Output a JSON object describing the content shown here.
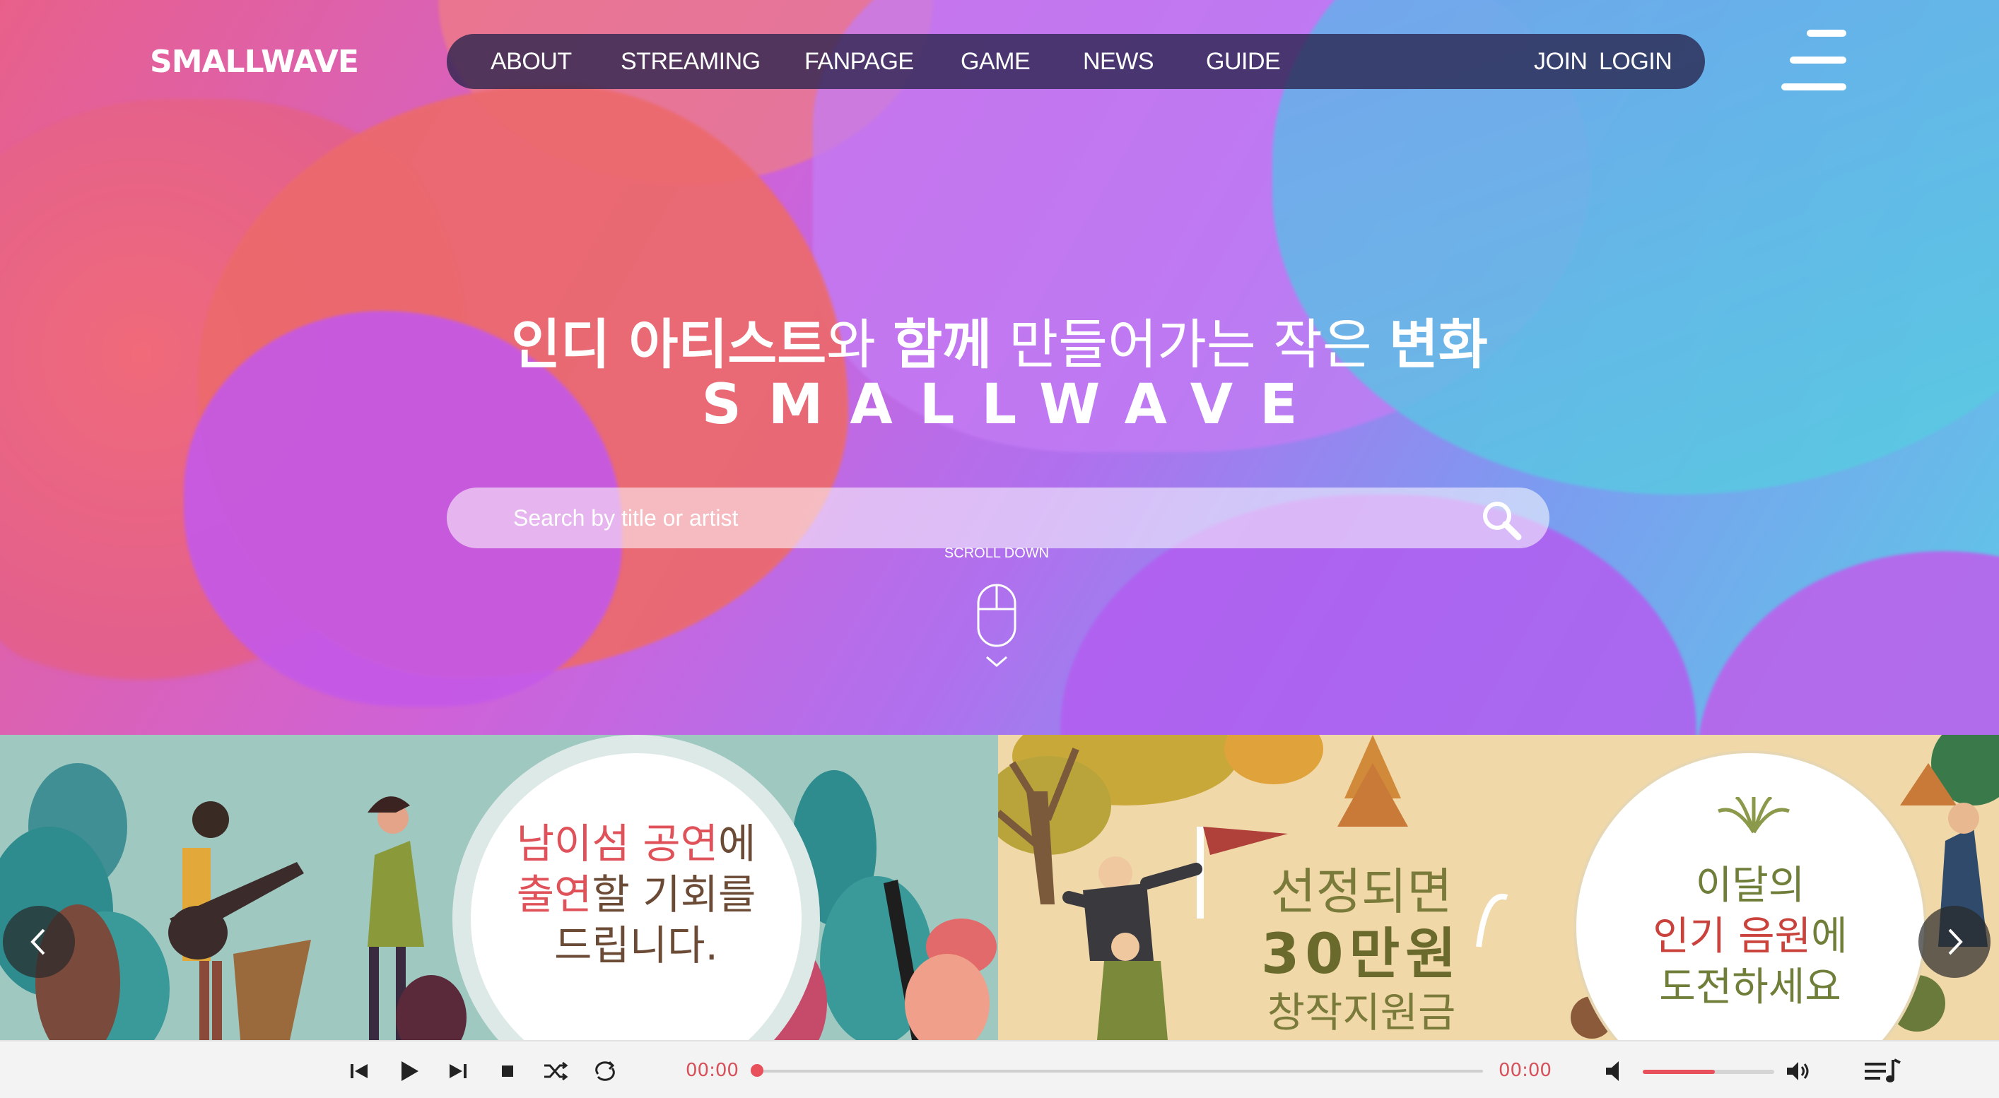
{
  "header": {
    "logo": "SMALLWAVE",
    "nav": [
      "ABOUT",
      "STREAMING",
      "FANPAGE",
      "GAME",
      "NEWS",
      "GUIDE"
    ],
    "join": "JOIN",
    "login": "LOGIN"
  },
  "hero": {
    "tagline_parts": [
      "인디 아티스트",
      "와 ",
      "함께",
      " 만들어가는 작은 ",
      "변화"
    ],
    "brand": "SMALLWAVE",
    "search_placeholder": "Search by title or artist",
    "scroll_label": "SCROLL DOWN"
  },
  "banners": {
    "left": {
      "line1_red": "남이섬 공연",
      "line1_rest": "에",
      "line2_red": "출연",
      "line2_rest": "할 기회를",
      "line3": "드립니다."
    },
    "middle": {
      "line1": "선정되면",
      "line2": "30만원",
      "line3": "창작지원금"
    },
    "right": {
      "line1": "이달의",
      "line2_red": "인기 음원",
      "line2_rest": "에",
      "line3": "도전하세요"
    }
  },
  "player": {
    "current_time": "00:00",
    "total_time": "00:00",
    "progress": 0,
    "volume": 0.55
  },
  "colors": {
    "accent": "#e8505c",
    "nav_bg": "#28234b"
  }
}
